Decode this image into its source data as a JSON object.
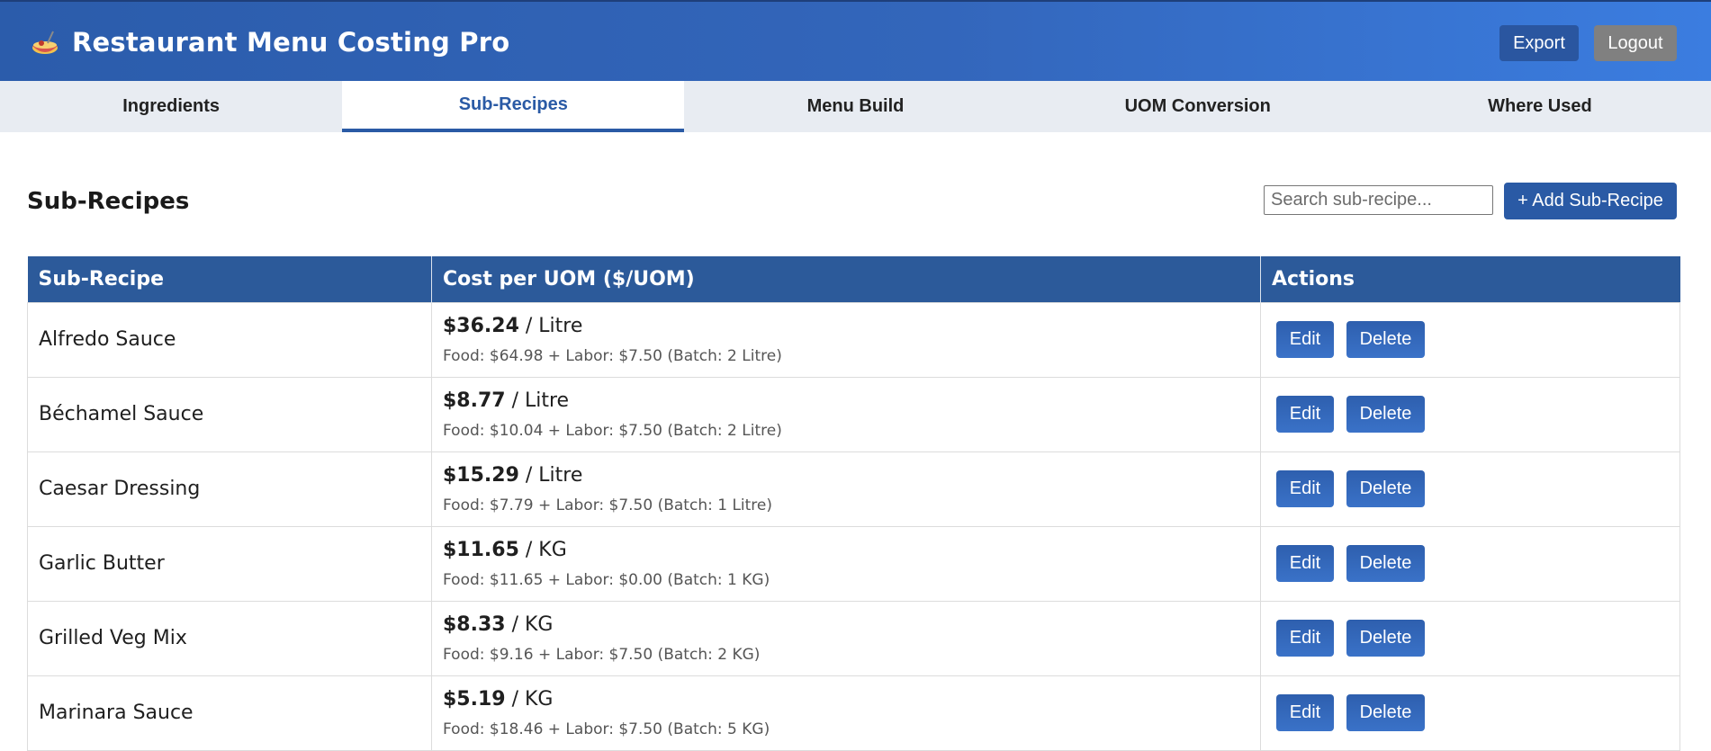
{
  "header": {
    "title": "Restaurant Menu Costing Pro",
    "logo_icon": "pasta-bowl-icon",
    "export_label": "Export",
    "logout_label": "Logout",
    "colors": {
      "primary": "#2a5aa5",
      "secondary_button": "#808080"
    }
  },
  "tabs": [
    {
      "label": "Ingredients",
      "active": false
    },
    {
      "label": "Sub-Recipes",
      "active": true
    },
    {
      "label": "Menu Build",
      "active": false
    },
    {
      "label": "UOM Conversion",
      "active": false
    },
    {
      "label": "Where Used",
      "active": false
    }
  ],
  "section": {
    "title": "Sub-Recipes",
    "search_placeholder": "Search sub-recipe...",
    "add_label": "+ Add Sub-Recipe"
  },
  "table": {
    "columns": [
      "Sub-Recipe",
      "Cost per UOM ($/UOM)",
      "Actions"
    ],
    "edit_label": "Edit",
    "delete_label": "Delete",
    "rows": [
      {
        "name": "Alfredo Sauce",
        "cost": "$36.24",
        "uom": " / Litre",
        "detail": "Food: $64.98 + Labor: $7.50 (Batch: 2 Litre)"
      },
      {
        "name": "Béchamel Sauce",
        "cost": "$8.77",
        "uom": " / Litre",
        "detail": "Food: $10.04 + Labor: $7.50 (Batch: 2 Litre)"
      },
      {
        "name": "Caesar Dressing",
        "cost": "$15.29",
        "uom": " / Litre",
        "detail": "Food: $7.79 + Labor: $7.50 (Batch: 1 Litre)"
      },
      {
        "name": "Garlic Butter",
        "cost": "$11.65",
        "uom": " / KG",
        "detail": "Food: $11.65 + Labor: $0.00 (Batch: 1 KG)"
      },
      {
        "name": "Grilled Veg Mix",
        "cost": "$8.33",
        "uom": " / KG",
        "detail": "Food: $9.16 + Labor: $7.50 (Batch: 2 KG)"
      },
      {
        "name": "Marinara Sauce",
        "cost": "$5.19",
        "uom": " / KG",
        "detail": "Food: $18.46 + Labor: $7.50 (Batch: 5 KG)"
      }
    ]
  }
}
